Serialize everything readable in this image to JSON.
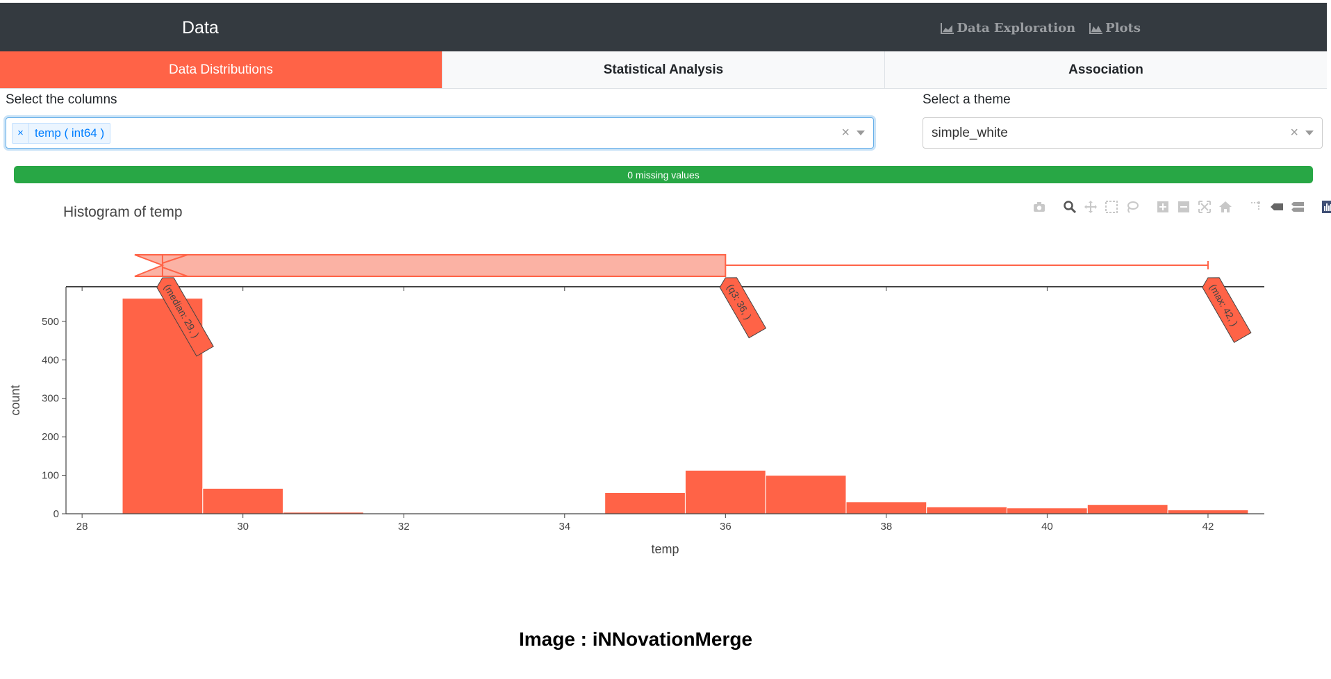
{
  "navbar": {
    "brand": "Data",
    "links": [
      {
        "label": "Data Exploration",
        "icon": "area-chart-icon"
      },
      {
        "label": "Plots",
        "icon": "mountain-chart-icon"
      }
    ]
  },
  "tabs": [
    {
      "label": "Data Distributions",
      "active": true
    },
    {
      "label": "Statistical Analysis",
      "active": false
    },
    {
      "label": "Association",
      "active": false
    }
  ],
  "columns_select": {
    "label": "Select the columns",
    "chip_label": "temp ( int64 )",
    "chip_remove": "×",
    "clear": "×"
  },
  "theme_select": {
    "label": "Select a theme",
    "value": "simple_white",
    "clear": "×"
  },
  "missing": {
    "text": "0 missing values",
    "fraction": 1.0,
    "color": "#28a745"
  },
  "chart": {
    "title": "Histogram of temp",
    "modebar_icons": [
      "camera-icon",
      "zoom-icon",
      "pan-icon",
      "box-select-icon",
      "lasso-icon",
      "zoom-in-icon",
      "zoom-out-icon",
      "autoscale-icon",
      "reset-axes-icon",
      "spike-lines-icon",
      "hover-closest-icon",
      "hover-compare-icon",
      "plotly-logo-icon"
    ]
  },
  "chart_data": {
    "type": "bar",
    "title": "Histogram of temp",
    "xlabel": "temp",
    "ylabel": "count",
    "xlim": [
      27.8,
      42.7
    ],
    "ylim": [
      0,
      590
    ],
    "xticks": [
      28,
      30,
      32,
      34,
      36,
      38,
      40,
      42
    ],
    "yticks": [
      0,
      100,
      200,
      300,
      400,
      500
    ],
    "bin_width": 1,
    "bins": [
      {
        "x": 29,
        "count": 560
      },
      {
        "x": 30,
        "count": 66
      },
      {
        "x": 31,
        "count": 4
      },
      {
        "x": 35,
        "count": 55
      },
      {
        "x": 36,
        "count": 113
      },
      {
        "x": 37,
        "count": 100
      },
      {
        "x": 38,
        "count": 31
      },
      {
        "x": 39,
        "count": 18
      },
      {
        "x": 40,
        "count": 15
      },
      {
        "x": 41,
        "count": 24
      },
      {
        "x": 42,
        "count": 10
      }
    ],
    "color": "#ff6347",
    "box": {
      "min": 29,
      "median": 29,
      "q1": 29,
      "q3": 36,
      "max": 42
    },
    "annotations": [
      {
        "text": "(median: 29, )",
        "x": 29
      },
      {
        "text": "(q3: 36, )",
        "x": 36
      },
      {
        "text": "(max: 42, )",
        "x": 42
      }
    ]
  },
  "credit": "Image : iNNovationMerge"
}
